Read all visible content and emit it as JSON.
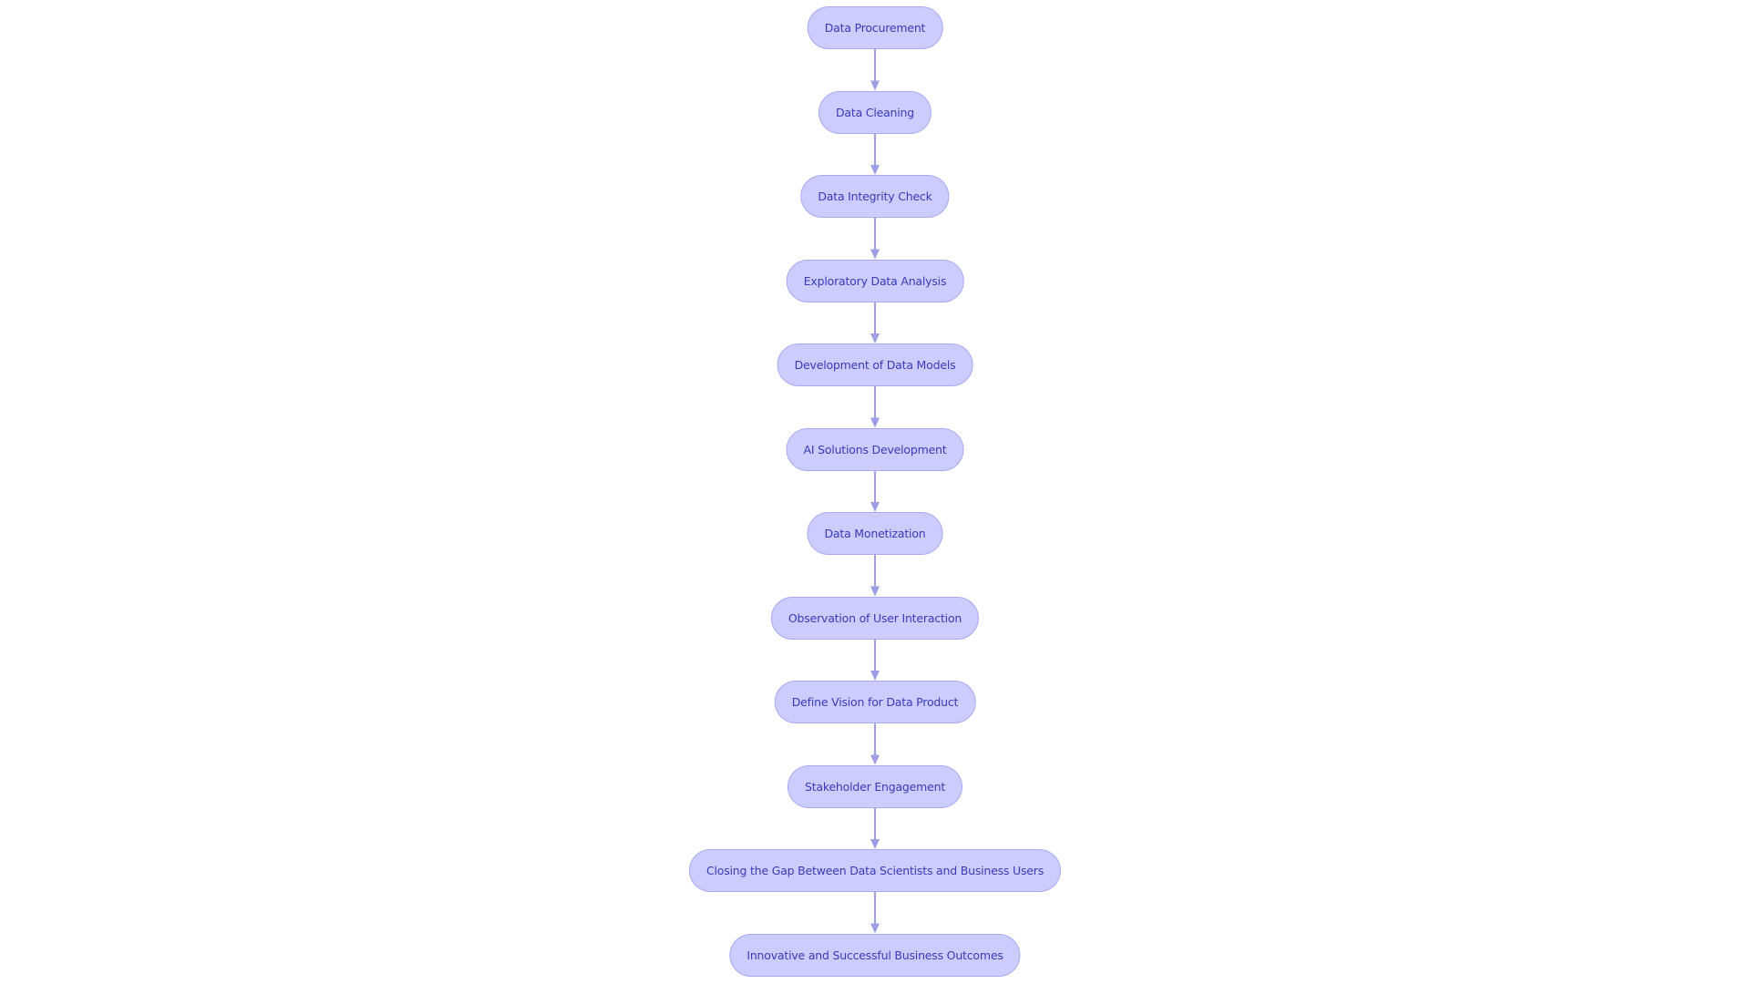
{
  "diagram": {
    "type": "flowchart",
    "direction": "top-to-bottom",
    "colors": {
      "node_fill": "#ccccff",
      "node_border": "#a9a9f0",
      "node_text": "#3a3ab8",
      "edge": "#9e9ee6"
    },
    "nodes": [
      {
        "id": "n1",
        "label": "Data Procurement"
      },
      {
        "id": "n2",
        "label": "Data Cleaning"
      },
      {
        "id": "n3",
        "label": "Data Integrity Check"
      },
      {
        "id": "n4",
        "label": "Exploratory Data Analysis"
      },
      {
        "id": "n5",
        "label": "Development of Data Models"
      },
      {
        "id": "n6",
        "label": "AI Solutions Development"
      },
      {
        "id": "n7",
        "label": "Data Monetization"
      },
      {
        "id": "n8",
        "label": "Observation of User Interaction"
      },
      {
        "id": "n9",
        "label": "Define Vision for Data Product"
      },
      {
        "id": "n10",
        "label": "Stakeholder Engagement"
      },
      {
        "id": "n11",
        "label": "Closing the Gap Between Data Scientists and Business Users"
      },
      {
        "id": "n12",
        "label": "Innovative and Successful Business Outcomes"
      }
    ],
    "edges": [
      {
        "from": "n1",
        "to": "n2"
      },
      {
        "from": "n2",
        "to": "n3"
      },
      {
        "from": "n3",
        "to": "n4"
      },
      {
        "from": "n4",
        "to": "n5"
      },
      {
        "from": "n5",
        "to": "n6"
      },
      {
        "from": "n6",
        "to": "n7"
      },
      {
        "from": "n7",
        "to": "n8"
      },
      {
        "from": "n8",
        "to": "n9"
      },
      {
        "from": "n9",
        "to": "n10"
      },
      {
        "from": "n10",
        "to": "n11"
      },
      {
        "from": "n11",
        "to": "n12"
      }
    ]
  }
}
